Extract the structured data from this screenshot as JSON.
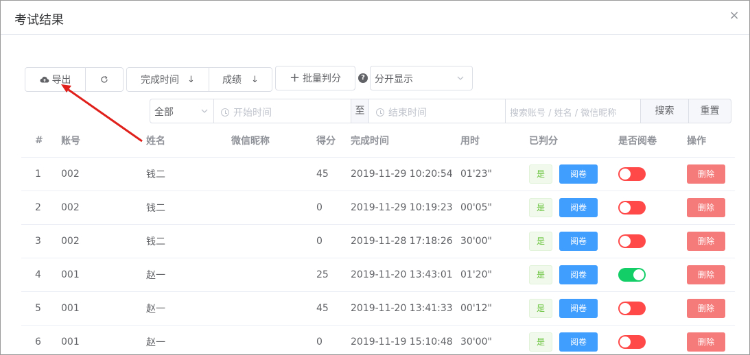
{
  "dialog": {
    "title": "考试结果",
    "close_glyph": "×"
  },
  "toolbar": {
    "export_label": "导出",
    "sort_time_label": "完成时间",
    "sort_score_label": "成绩",
    "sort_glyph": "↓",
    "batch_label": "批量判分",
    "batch_glyph": "+",
    "help_glyph": "?",
    "display_mode": "分开显示"
  },
  "filters": {
    "status": "全部",
    "start_placeholder": "开始时间",
    "range_separator": "至",
    "end_placeholder": "结束时间",
    "search_placeholder": "搜索账号 / 姓名 / 微信昵称",
    "search_label": "搜索",
    "reset_label": "重置"
  },
  "table": {
    "headers": [
      "#",
      "账号",
      "姓名",
      "微信昵称",
      "得分",
      "完成时间",
      "用时",
      "已判分",
      "是否阅卷",
      "操作"
    ],
    "graded_label": "是",
    "review_label": "阅卷",
    "delete_label": "删除",
    "rows": [
      {
        "idx": "1",
        "account": "002",
        "name": "钱二",
        "wechat": "",
        "score": "45",
        "finished": "2019-11-29 10:20:54",
        "duration": "01'23\"",
        "reviewed": false
      },
      {
        "idx": "2",
        "account": "002",
        "name": "钱二",
        "wechat": "",
        "score": "0",
        "finished": "2019-11-29 10:19:23",
        "duration": "00'05\"",
        "reviewed": false
      },
      {
        "idx": "3",
        "account": "002",
        "name": "钱二",
        "wechat": "",
        "score": "0",
        "finished": "2019-11-28 17:18:26",
        "duration": "30'00\"",
        "reviewed": false
      },
      {
        "idx": "4",
        "account": "001",
        "name": "赵一",
        "wechat": "",
        "score": "25",
        "finished": "2019-11-20 13:43:01",
        "duration": "01'20\"",
        "reviewed": true
      },
      {
        "idx": "5",
        "account": "001",
        "name": "赵一",
        "wechat": "",
        "score": "45",
        "finished": "2019-11-20 13:41:33",
        "duration": "00'12\"",
        "reviewed": false
      },
      {
        "idx": "6",
        "account": "001",
        "name": "赵一",
        "wechat": "",
        "score": "0",
        "finished": "2019-11-19 15:10:48",
        "duration": "30'00\"",
        "reviewed": false
      }
    ]
  },
  "colors": {
    "primary": "#409eff",
    "danger": "#f56c6c",
    "switch_on": "#13ce66",
    "switch_off": "#ff4949",
    "success": "#67c23a",
    "annotation_arrow": "#e0201b"
  },
  "icons": [
    "cloud-upload-icon",
    "refresh-icon",
    "sort-down-icon",
    "plus-icon",
    "help-icon",
    "chevron-down-icon",
    "clock-icon",
    "close-icon",
    "annotation-arrow"
  ]
}
